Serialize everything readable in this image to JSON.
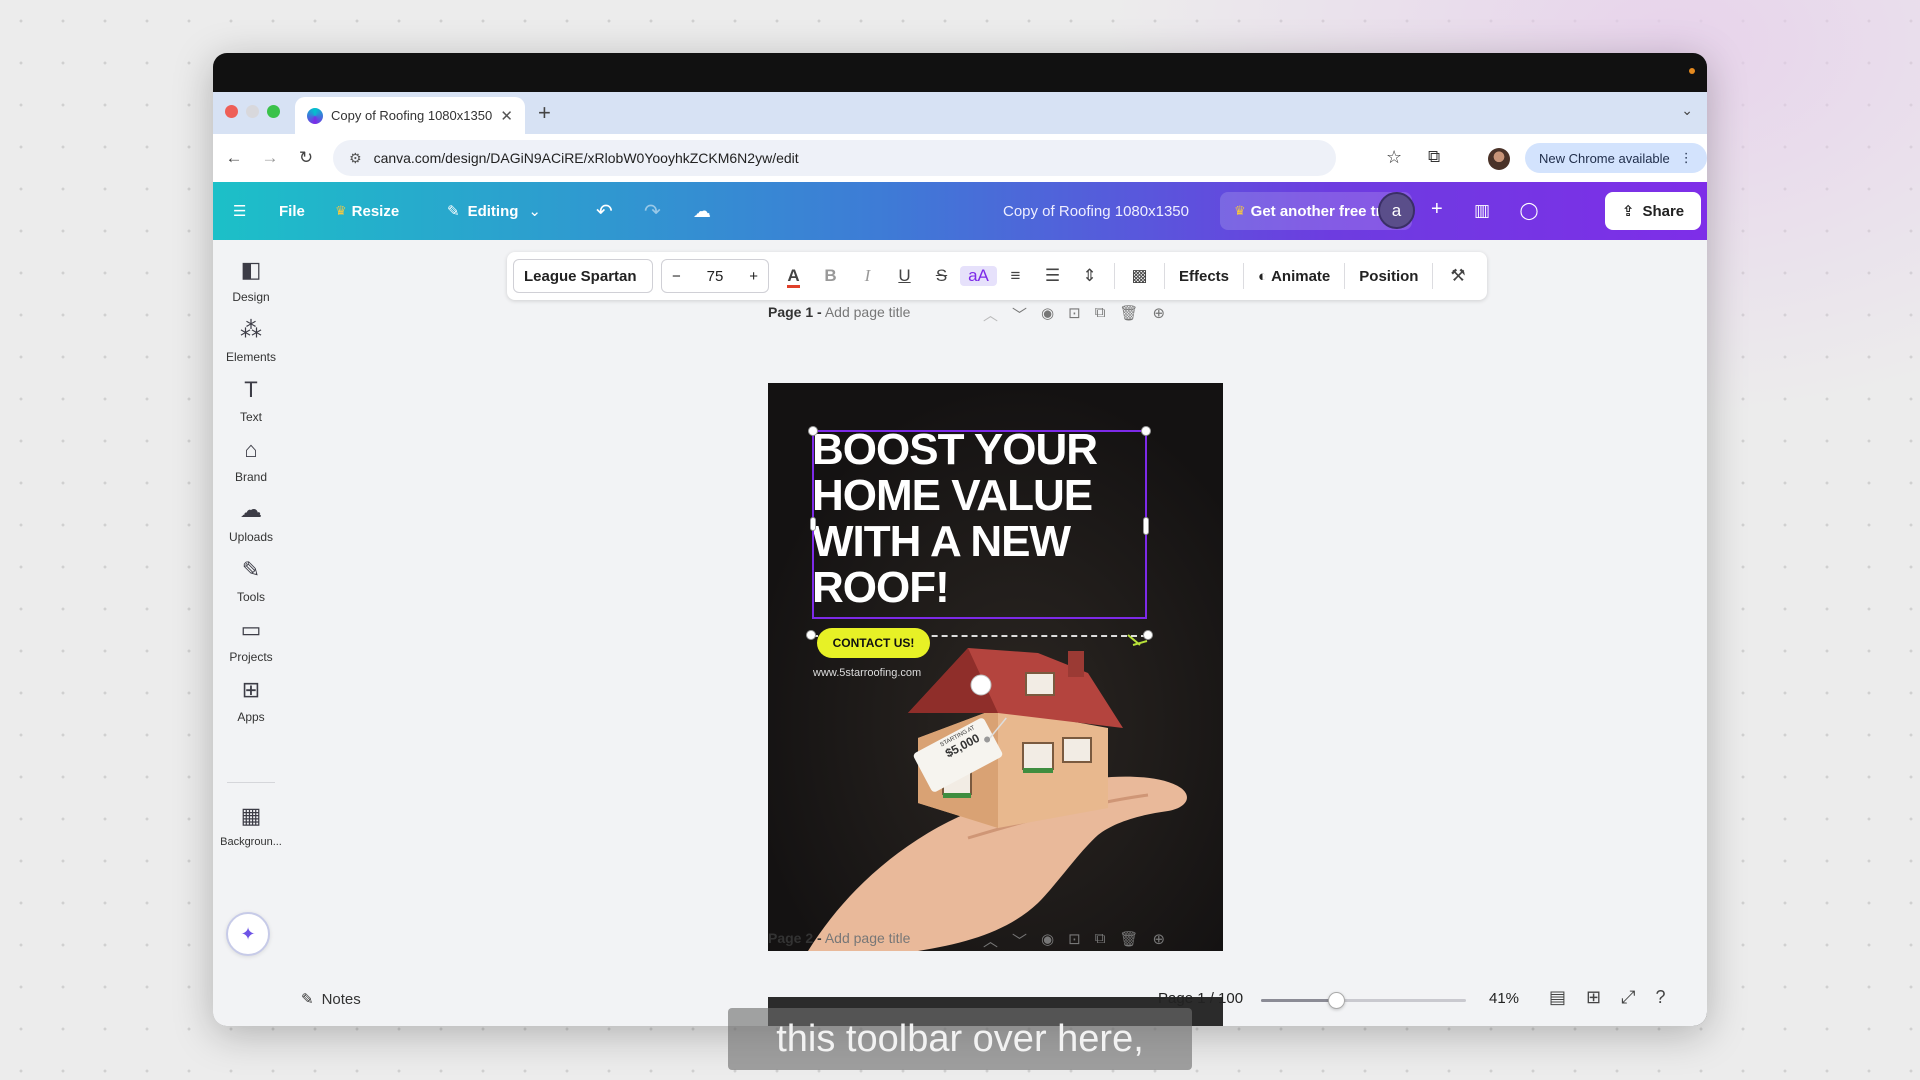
{
  "browser": {
    "tab_title": "Copy of Roofing 1080x1350",
    "tab_close": "✕",
    "new_tab": "+",
    "url": "canva.com/design/DAGiN9ACiRE/xRlobW0YooyhkZCKM6N2yw/edit",
    "new_chrome": "New Chrome available"
  },
  "canva_header": {
    "menu_icon": "hamburger-icon",
    "file": "File",
    "resize": "Resize",
    "editing": "Editing",
    "document_title": "Copy of Roofing 1080x1350",
    "trial": "Get another free trial",
    "avatar_letter": "a",
    "share": "Share"
  },
  "sidebar": {
    "items": [
      {
        "label": "Design",
        "icon": "design-icon"
      },
      {
        "label": "Elements",
        "icon": "elements-icon"
      },
      {
        "label": "Text",
        "icon": "text-icon"
      },
      {
        "label": "Brand",
        "icon": "brand-icon"
      },
      {
        "label": "Uploads",
        "icon": "uploads-icon"
      },
      {
        "label": "Tools",
        "icon": "tools-icon"
      },
      {
        "label": "Projects",
        "icon": "projects-icon"
      },
      {
        "label": "Apps",
        "icon": "apps-icon"
      },
      {
        "label": "Backgroun...",
        "icon": "background-icon"
      }
    ]
  },
  "editor_toolbar": {
    "font": "League Spartan",
    "font_size": "75",
    "minus": "−",
    "plus": "+",
    "effects": "Effects",
    "animate": "Animate",
    "position": "Position"
  },
  "pages": {
    "page1_label": "Page 1 -",
    "page1_title_placeholder": "Add page title",
    "page2_label": "Page 2 -",
    "page2_title_placeholder": "Add page title"
  },
  "design": {
    "headline": "BOOST YOUR\nHOME VALUE\nWITH A NEW\nROOF!",
    "cta": "CONTACT US!",
    "website": "www.5starroofing.com",
    "tag_small": "STARTING AT",
    "tag_price": "$5,000"
  },
  "footer": {
    "notes": "Notes",
    "page_count": "Page 1 / 100",
    "zoom": "41%",
    "zoom_fraction": 0.41
  },
  "caption": "this toolbar over here,",
  "colors": {
    "brand_gradient_start": "#1cc0c8",
    "brand_gradient_end": "#7e2ee8",
    "selection": "#7d2ae8",
    "cta": "#e7f126"
  }
}
